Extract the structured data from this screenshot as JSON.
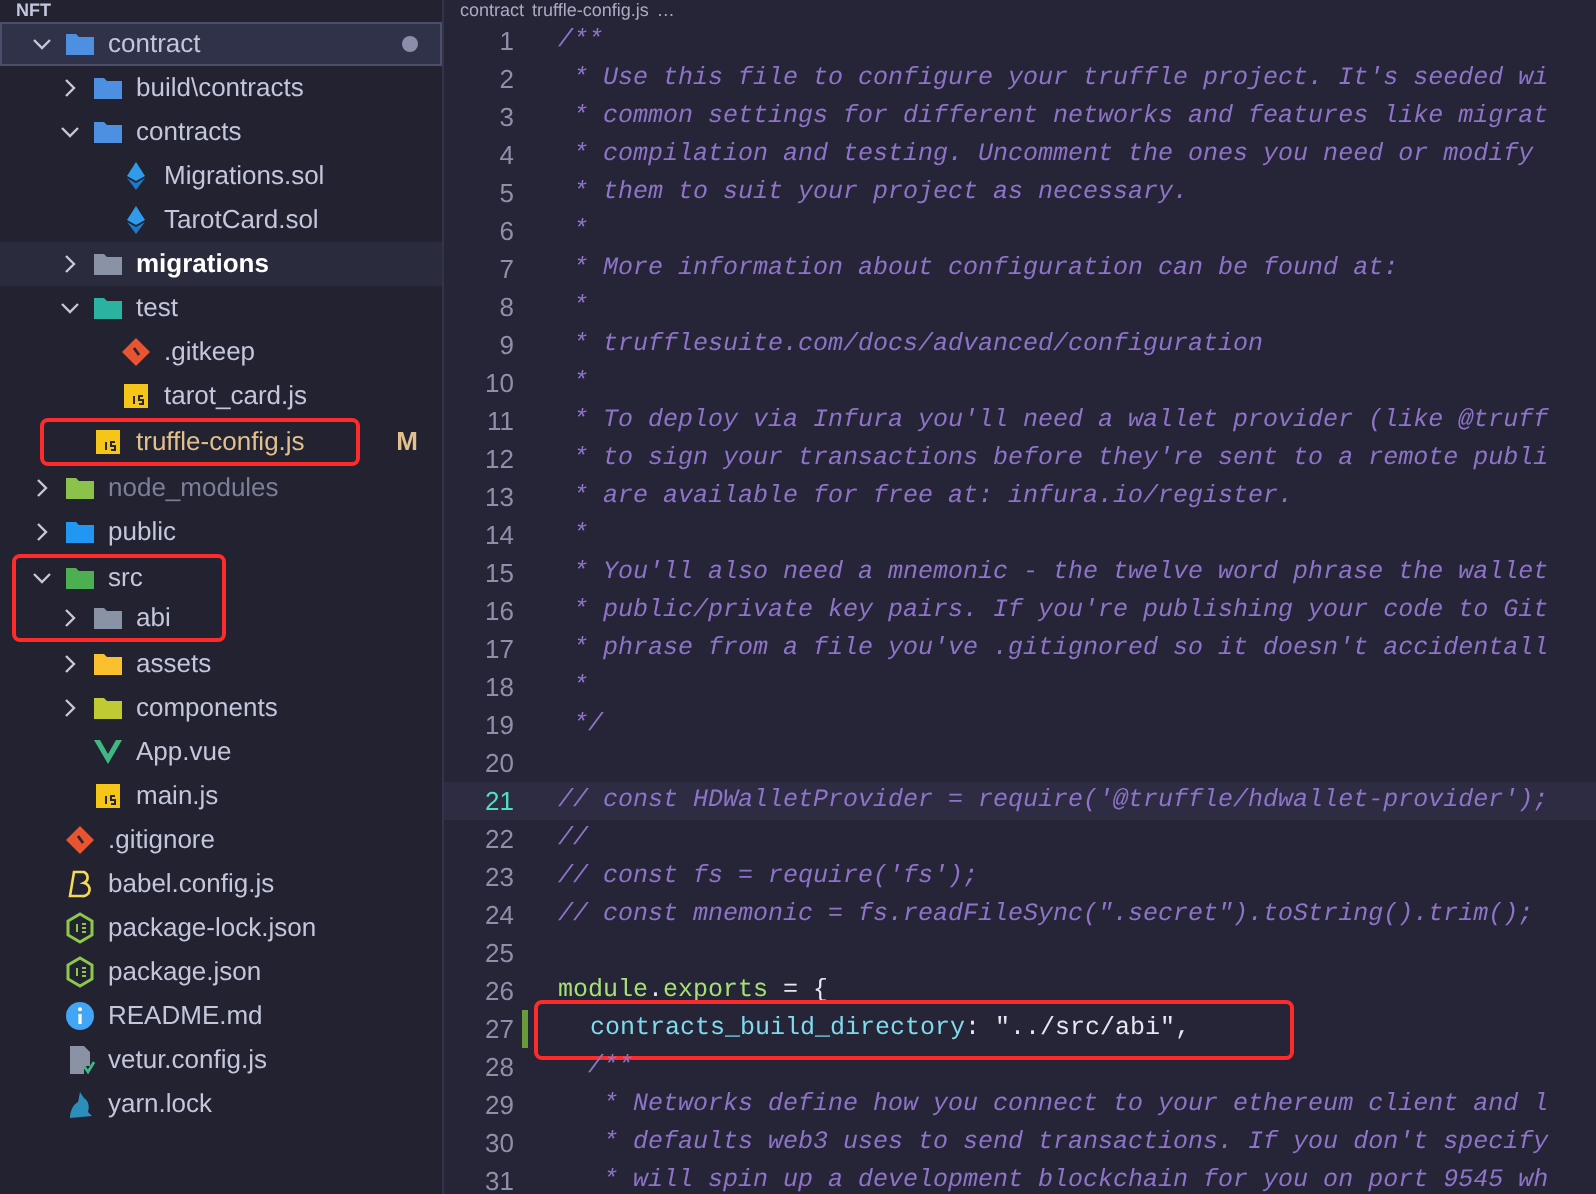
{
  "sidebar": {
    "title": "NFT",
    "tree": [
      {
        "name": "contract",
        "kind": "folder",
        "color": "#4d8fe0",
        "expanded": true,
        "selected": true,
        "hovered": false,
        "dimmed": false,
        "annotated": false,
        "modified_dot": true,
        "children": [
          {
            "name": "build\\contracts",
            "kind": "folder",
            "color": "#4d8fe0",
            "expanded": false,
            "selected": false,
            "hovered": false,
            "dimmed": false,
            "annotated": false,
            "modified_dot": false
          },
          {
            "name": "contracts",
            "kind": "folder",
            "color": "#4d8fe0",
            "expanded": true,
            "selected": false,
            "hovered": false,
            "dimmed": false,
            "annotated": false,
            "modified_dot": false,
            "children": [
              {
                "name": "Migrations.sol",
                "kind": "ethereum",
                "selected": false,
                "hovered": false,
                "dimmed": false,
                "annotated": false,
                "modified_dot": false
              },
              {
                "name": "TarotCard.sol",
                "kind": "ethereum",
                "selected": false,
                "hovered": false,
                "dimmed": false,
                "annotated": false,
                "modified_dot": false
              }
            ]
          },
          {
            "name": "migrations",
            "kind": "folder",
            "color": "#8a93a6",
            "expanded": false,
            "selected": false,
            "hovered": true,
            "dimmed": false,
            "annotated": false,
            "modified_dot": false
          },
          {
            "name": "test",
            "kind": "folder",
            "color": "#2bb3a0",
            "expanded": true,
            "selected": false,
            "hovered": false,
            "dimmed": false,
            "annotated": false,
            "modified_dot": false,
            "children": [
              {
                "name": ".gitkeep",
                "kind": "git",
                "selected": false,
                "hovered": false,
                "dimmed": false,
                "annotated": false,
                "modified_dot": false
              },
              {
                "name": "tarot_card.js",
                "kind": "js",
                "selected": false,
                "hovered": false,
                "dimmed": false,
                "annotated": false,
                "modified_dot": false
              }
            ]
          },
          {
            "name": "truffle-config.js",
            "kind": "js",
            "git_status": "M",
            "selected": false,
            "hovered": false,
            "dimmed": false,
            "annotated": true,
            "modified_dot": false
          }
        ]
      },
      {
        "name": "node_modules",
        "kind": "folder",
        "color": "#8bc34a",
        "expanded": false,
        "selected": false,
        "hovered": false,
        "dimmed": true,
        "annotated": false,
        "modified_dot": false
      },
      {
        "name": "public",
        "kind": "folder",
        "color": "#2196f3",
        "expanded": false,
        "selected": false,
        "hovered": false,
        "dimmed": false,
        "annotated": false,
        "modified_dot": false
      },
      {
        "name": "src",
        "kind": "folder",
        "color": "#4caf50",
        "expanded": true,
        "selected": false,
        "hovered": false,
        "dimmed": false,
        "annotated": true,
        "modified_dot": false,
        "children": [
          {
            "name": "abi",
            "kind": "folder",
            "color": "#8a93a6",
            "expanded": false,
            "selected": false,
            "hovered": false,
            "dimmed": false,
            "annotated": true,
            "modified_dot": false
          },
          {
            "name": "assets",
            "kind": "folder",
            "color": "#fbc02d",
            "expanded": false,
            "selected": false,
            "hovered": false,
            "dimmed": false,
            "annotated": false,
            "modified_dot": false
          },
          {
            "name": "components",
            "kind": "folder",
            "color": "#c0ca33",
            "expanded": false,
            "selected": false,
            "hovered": false,
            "dimmed": false,
            "annotated": false,
            "modified_dot": false
          },
          {
            "name": "App.vue",
            "kind": "vue",
            "selected": false,
            "hovered": false,
            "dimmed": false,
            "annotated": false,
            "modified_dot": false
          },
          {
            "name": "main.js",
            "kind": "js",
            "selected": false,
            "hovered": false,
            "dimmed": false,
            "annotated": false,
            "modified_dot": false
          }
        ]
      },
      {
        "name": ".gitignore",
        "kind": "git",
        "selected": false,
        "hovered": false,
        "dimmed": false,
        "annotated": false,
        "modified_dot": false
      },
      {
        "name": "babel.config.js",
        "kind": "babel",
        "selected": false,
        "hovered": false,
        "dimmed": false,
        "annotated": false,
        "modified_dot": false
      },
      {
        "name": "package-lock.json",
        "kind": "nodejs",
        "selected": false,
        "hovered": false,
        "dimmed": false,
        "annotated": false,
        "modified_dot": false
      },
      {
        "name": "package.json",
        "kind": "nodejs",
        "selected": false,
        "hovered": false,
        "dimmed": false,
        "annotated": false,
        "modified_dot": false
      },
      {
        "name": "README.md",
        "kind": "info",
        "selected": false,
        "hovered": false,
        "dimmed": false,
        "annotated": false,
        "modified_dot": false
      },
      {
        "name": "vetur.config.js",
        "kind": "doc",
        "selected": false,
        "hovered": false,
        "dimmed": false,
        "annotated": false,
        "modified_dot": false
      },
      {
        "name": "yarn.lock",
        "kind": "yarn",
        "selected": false,
        "hovered": false,
        "dimmed": false,
        "annotated": false,
        "modified_dot": false
      }
    ]
  },
  "breadcrumb": [
    "contract",
    "truffle-config.js",
    "…"
  ],
  "editor": {
    "lines": [
      {
        "number": "1",
        "current": false,
        "modified": false,
        "annotated": false,
        "tokens": [
          {
            "kind": "comment",
            "text": "/**"
          }
        ]
      },
      {
        "number": "2",
        "current": false,
        "modified": false,
        "annotated": false,
        "tokens": [
          {
            "kind": "comment",
            "text": " * Use this file to configure your truffle project. It's seeded wi"
          }
        ]
      },
      {
        "number": "3",
        "current": false,
        "modified": false,
        "annotated": false,
        "tokens": [
          {
            "kind": "comment",
            "text": " * common settings for different networks and features like migrat"
          }
        ]
      },
      {
        "number": "4",
        "current": false,
        "modified": false,
        "annotated": false,
        "tokens": [
          {
            "kind": "comment",
            "text": " * compilation and testing. Uncomment the ones you need or modify"
          }
        ]
      },
      {
        "number": "5",
        "current": false,
        "modified": false,
        "annotated": false,
        "tokens": [
          {
            "kind": "comment",
            "text": " * them to suit your project as necessary."
          }
        ]
      },
      {
        "number": "6",
        "current": false,
        "modified": false,
        "annotated": false,
        "tokens": [
          {
            "kind": "comment",
            "text": " *"
          }
        ]
      },
      {
        "number": "7",
        "current": false,
        "modified": false,
        "annotated": false,
        "tokens": [
          {
            "kind": "comment",
            "text": " * More information about configuration can be found at:"
          }
        ]
      },
      {
        "number": "8",
        "current": false,
        "modified": false,
        "annotated": false,
        "tokens": [
          {
            "kind": "comment",
            "text": " *"
          }
        ]
      },
      {
        "number": "9",
        "current": false,
        "modified": false,
        "annotated": false,
        "tokens": [
          {
            "kind": "comment",
            "text": " * trufflesuite.com/docs/advanced/configuration"
          }
        ]
      },
      {
        "number": "10",
        "current": false,
        "modified": false,
        "annotated": false,
        "tokens": [
          {
            "kind": "comment",
            "text": " *"
          }
        ]
      },
      {
        "number": "11",
        "current": false,
        "modified": false,
        "annotated": false,
        "tokens": [
          {
            "kind": "comment",
            "text": " * To deploy via Infura you'll need a wallet provider (like @truff"
          }
        ]
      },
      {
        "number": "12",
        "current": false,
        "modified": false,
        "annotated": false,
        "tokens": [
          {
            "kind": "comment",
            "text": " * to sign your transactions before they're sent to a remote publi"
          }
        ]
      },
      {
        "number": "13",
        "current": false,
        "modified": false,
        "annotated": false,
        "tokens": [
          {
            "kind": "comment",
            "text": " * are available for free at: infura.io/register."
          }
        ]
      },
      {
        "number": "14",
        "current": false,
        "modified": false,
        "annotated": false,
        "tokens": [
          {
            "kind": "comment",
            "text": " *"
          }
        ]
      },
      {
        "number": "15",
        "current": false,
        "modified": false,
        "annotated": false,
        "tokens": [
          {
            "kind": "comment",
            "text": " * You'll also need a mnemonic - the twelve word phrase the wallet"
          }
        ]
      },
      {
        "number": "16",
        "current": false,
        "modified": false,
        "annotated": false,
        "tokens": [
          {
            "kind": "comment",
            "text": " * public/private key pairs. If you're publishing your code to Git"
          }
        ]
      },
      {
        "number": "17",
        "current": false,
        "modified": false,
        "annotated": false,
        "tokens": [
          {
            "kind": "comment",
            "text": " * phrase from a file you've .gitignored so it doesn't accidentall"
          }
        ]
      },
      {
        "number": "18",
        "current": false,
        "modified": false,
        "annotated": false,
        "tokens": [
          {
            "kind": "comment",
            "text": " *"
          }
        ]
      },
      {
        "number": "19",
        "current": false,
        "modified": false,
        "annotated": false,
        "tokens": [
          {
            "kind": "comment",
            "text": " */"
          }
        ]
      },
      {
        "number": "20",
        "current": false,
        "modified": false,
        "annotated": false
      },
      {
        "number": "21",
        "current": true,
        "modified": false,
        "annotated": false,
        "tokens": [
          {
            "kind": "comment",
            "text": "// const HDWalletProvider = require('@truffle/hdwallet-provider');"
          }
        ]
      },
      {
        "number": "22",
        "current": false,
        "modified": false,
        "annotated": false,
        "tokens": [
          {
            "kind": "comment",
            "text": "//"
          }
        ]
      },
      {
        "number": "23",
        "current": false,
        "modified": false,
        "annotated": false,
        "tokens": [
          {
            "kind": "comment",
            "text": "// const fs = require('fs');"
          }
        ]
      },
      {
        "number": "24",
        "current": false,
        "modified": false,
        "annotated": false,
        "tokens": [
          {
            "kind": "comment",
            "text": "// const mnemonic = fs.readFileSync(\".secret\").toString().trim();"
          }
        ]
      },
      {
        "number": "25",
        "current": false,
        "modified": false,
        "annotated": false
      },
      {
        "number": "26",
        "current": false,
        "modified": false,
        "annotated": false,
        "tokens": [
          {
            "kind": "identifier",
            "text": "module"
          },
          {
            "kind": "plain",
            "text": "."
          },
          {
            "kind": "identifier",
            "text": "exports"
          },
          {
            "kind": "plain",
            "text": " = {"
          }
        ]
      },
      {
        "number": "27",
        "current": false,
        "modified": true,
        "annotated": true,
        "tokens": [
          {
            "kind": "property",
            "text": "contracts_build_directory"
          },
          {
            "kind": "plain",
            "text": ": "
          },
          {
            "kind": "string",
            "text": "\"../src/abi\""
          },
          {
            "kind": "plain",
            "text": ","
          }
        ]
      },
      {
        "number": "28",
        "current": false,
        "modified": false,
        "annotated": false,
        "tokens": [
          {
            "kind": "comment",
            "text": "  /**"
          }
        ]
      },
      {
        "number": "29",
        "current": false,
        "modified": false,
        "annotated": false,
        "tokens": [
          {
            "kind": "comment",
            "text": "   * Networks define how you connect to your ethereum client and l"
          }
        ]
      },
      {
        "number": "30",
        "current": false,
        "modified": false,
        "annotated": false,
        "tokens": [
          {
            "kind": "comment",
            "text": "   * defaults web3 uses to send transactions. If you don't specify"
          }
        ]
      },
      {
        "number": "31",
        "current": false,
        "modified": false,
        "annotated": false,
        "tokens": [
          {
            "kind": "comment",
            "text": "   * will spin up a development blockchain for you on port 9545 wh"
          }
        ]
      }
    ]
  }
}
